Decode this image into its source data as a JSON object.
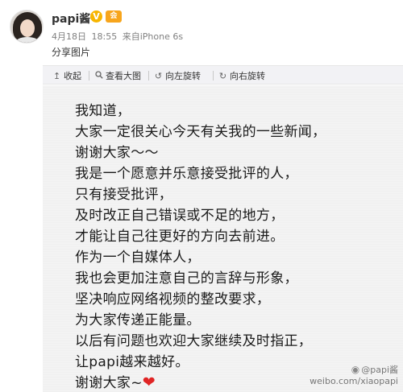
{
  "post": {
    "username": "papi酱",
    "vip_badge": "V",
    "member_badge": "会",
    "date": "4月18日",
    "time": "18:55",
    "source_prefix": "来自",
    "source": "iPhone 6s",
    "share_text": "分享图片"
  },
  "toolbar": {
    "items": [
      {
        "icon": "collapse-icon",
        "glyph": "↥",
        "label": "收起"
      },
      {
        "icon": "magnifier-icon",
        "glyph": "🔍",
        "label": "查看大图"
      },
      {
        "icon": "rotate-left-icon",
        "glyph": "↺",
        "label": "向左旋转"
      },
      {
        "icon": "rotate-right-icon",
        "glyph": "↻",
        "label": "向右旋转"
      }
    ]
  },
  "image": {
    "lines": [
      "我知道，",
      "大家一定很关心今天有关我的一些新闻，",
      "谢谢大家～～",
      "我是一个愿意并乐意接受批评的人，",
      "只有接受批评，",
      "及时改正自己错误或不足的地方，",
      "才能让自己往更好的方向去前进。",
      "作为一个自媒体人，",
      "我也会更加注意自己的言辞与形象，",
      "坚决响应网络视频的整改要求，",
      "为大家传递正能量。",
      "以后有问题也欢迎大家继续及时指正，",
      "让papi越来越好。",
      "谢谢大家~"
    ],
    "heart_color": "#e02424",
    "watermark_handle": "@papi酱",
    "watermark_url": "weibo.com/xiaopapi"
  },
  "colors": {
    "toolbar_bg": "#f2f2f5",
    "image_bg": "#f3f3f3",
    "badge_vip": "#f7b500"
  }
}
